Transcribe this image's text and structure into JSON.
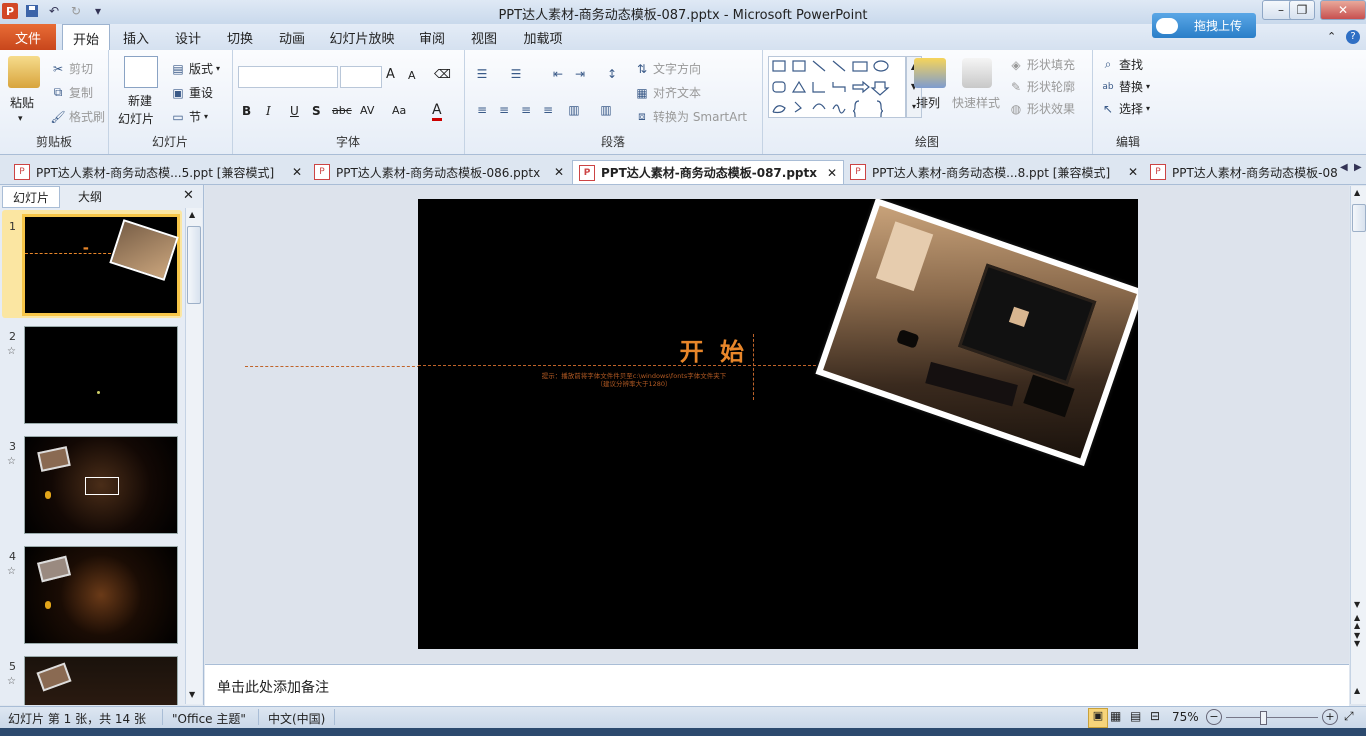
{
  "window": {
    "title": "PPT达人素材-商务动态模板-087.pptx  -  Microsoft PowerPoint",
    "app_logo": "P",
    "minimize": "–",
    "restore": "❐",
    "close": "✕"
  },
  "upload_button": "拖拽上传",
  "ribbon_tabs": [
    "文件",
    "开始",
    "插入",
    "设计",
    "切换",
    "动画",
    "幻灯片放映",
    "审阅",
    "视图",
    "加载项"
  ],
  "clipboard": {
    "paste": "粘贴",
    "cut": "剪切",
    "copy": "复制",
    "format_painter": "格式刷",
    "label": "剪贴板"
  },
  "slides_group": {
    "new_slide": "新建",
    "new_slide2": "幻灯片",
    "layout": "版式",
    "reset": "重设",
    "section": "节",
    "label": "幻灯片"
  },
  "font_group": {
    "label": "字体",
    "bold": "B",
    "italic": "I",
    "underline": "U",
    "shadow": "S",
    "strike": "abc",
    "spacing": "AV",
    "case": "Aa",
    "grow": "A",
    "shrink": "A",
    "color": "A"
  },
  "paragraph_group": {
    "text_direction": "文字方向",
    "align_text": "对齐文本",
    "smartart": "转换为 SmartArt",
    "label": "段落"
  },
  "drawing_group": {
    "arrange": "排列",
    "quick_styles": "快速样式",
    "fill": "形状填充",
    "outline": "形状轮廓",
    "effects": "形状效果",
    "label": "绘图"
  },
  "editing_group": {
    "find": "查找",
    "replace": "替换",
    "select": "选择",
    "label": "编辑"
  },
  "doc_tabs": [
    {
      "label": "PPT达人素材-商务动态模...5.ppt [兼容模式]",
      "active": false
    },
    {
      "label": "PPT达人素材-商务动态模板-086.pptx",
      "active": false
    },
    {
      "label": "PPT达人素材-商务动态模板-087.pptx",
      "active": true
    },
    {
      "label": "PPT达人素材-商务动态模...8.ppt [兼容模式]",
      "active": false
    },
    {
      "label": "PPT达人素材-商务动态模板-08",
      "active": false
    }
  ],
  "panel_tabs": {
    "slides": "幻灯片",
    "outline": "大纲",
    "close": "✕"
  },
  "thumbnails": [
    {
      "num": "1",
      "star": ""
    },
    {
      "num": "2",
      "star": "☆"
    },
    {
      "num": "3",
      "star": "☆"
    },
    {
      "num": "4",
      "star": "☆"
    },
    {
      "num": "5",
      "star": "☆"
    }
  ],
  "slide": {
    "title": "开 始",
    "hint_line1": "提示：播放前将字体文件件贝至c:\\windows\\fonts字体文件夹下",
    "hint_line2": "（建议分辨率大于1280）",
    "accent_color": "#e8862a"
  },
  "notes_placeholder": "单击此处添加备注",
  "status": {
    "slide_info": "幻灯片 第 1 张，共 14 张",
    "theme": "\"Office 主题\"",
    "language": "中文(中国)",
    "zoom": "75%",
    "zoom_level_fraction": 0.4
  }
}
